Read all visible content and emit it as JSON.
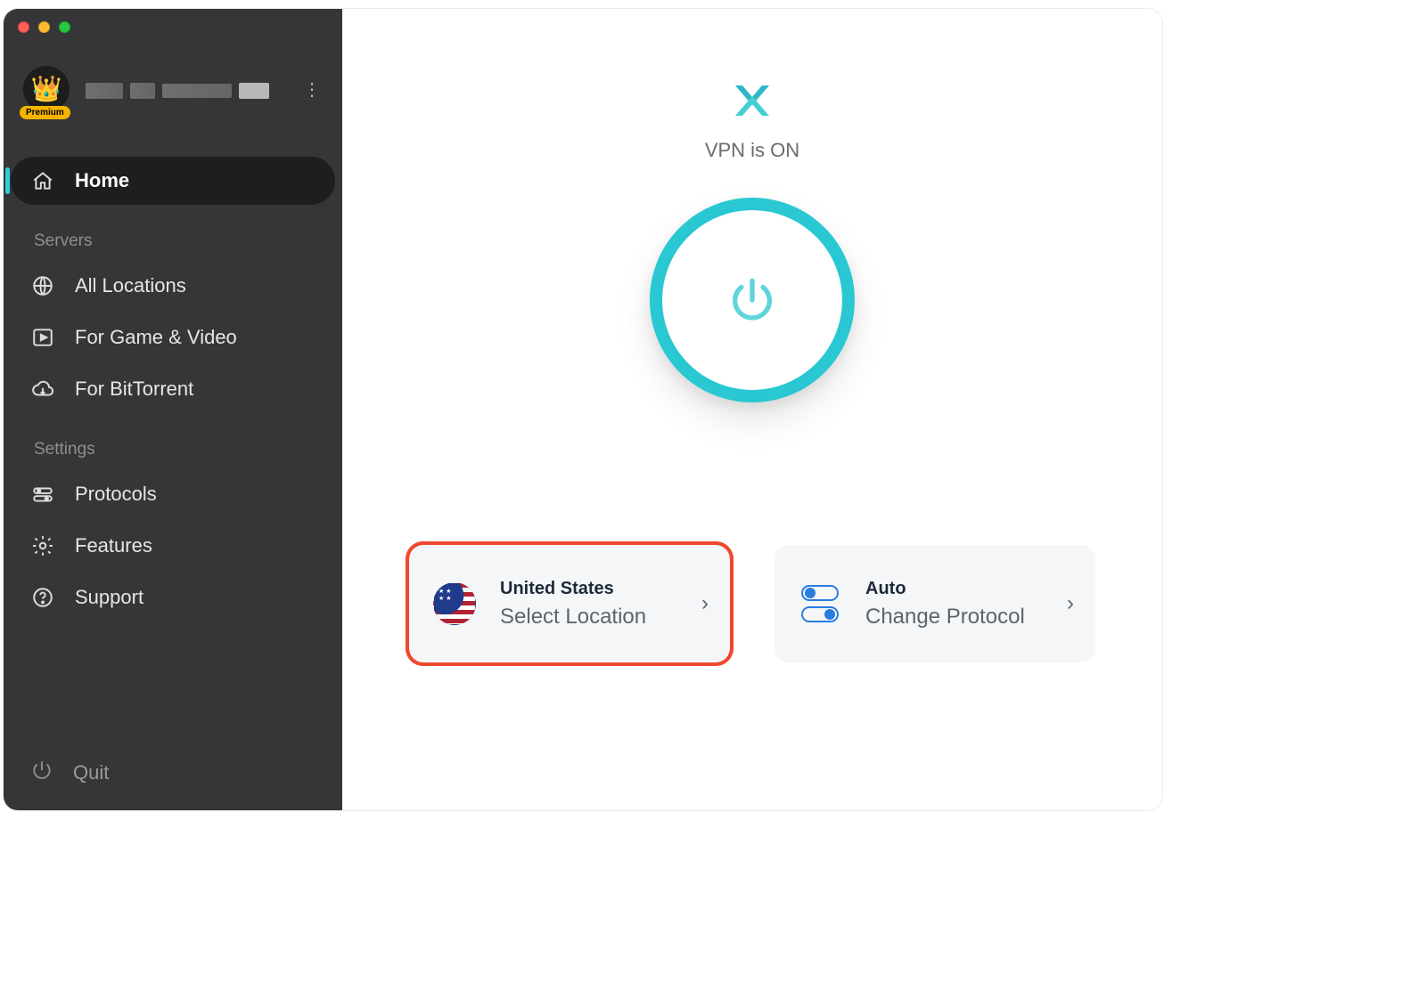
{
  "account": {
    "premium_label": "Premium"
  },
  "sidebar": {
    "items": [
      {
        "label": "Home"
      },
      {
        "label": "All Locations"
      },
      {
        "label": "For Game & Video"
      },
      {
        "label": "For BitTorrent"
      },
      {
        "label": "Protocols"
      },
      {
        "label": "Features"
      },
      {
        "label": "Support"
      }
    ],
    "sections": {
      "servers": "Servers",
      "settings": "Settings"
    },
    "quit_label": "Quit"
  },
  "main": {
    "status_text": "VPN is ON",
    "location_card": {
      "title": "United States",
      "subtitle": "Select Location"
    },
    "protocol_card": {
      "title": "Auto",
      "subtitle": "Change Protocol"
    }
  },
  "colors": {
    "accent": "#29c8d3",
    "sidebar_bg": "#3b3b3d",
    "highlight_border": "#f04830"
  }
}
